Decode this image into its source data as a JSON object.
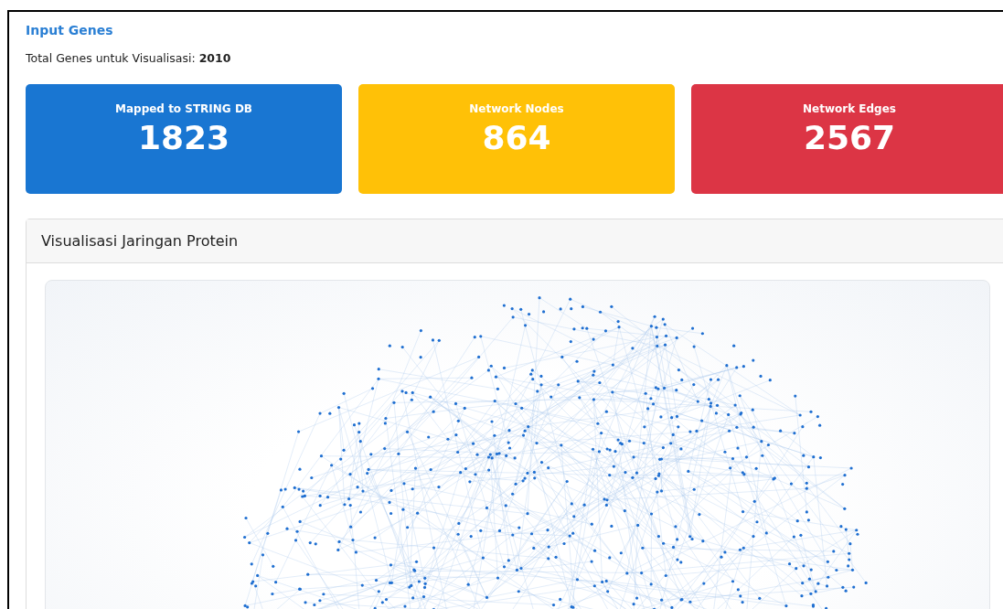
{
  "section_link": "Input Genes",
  "total_genes": {
    "label": "Total Genes untuk Visualisasi:",
    "value": "2010"
  },
  "stat_cards": [
    {
      "label": "Mapped to STRING DB",
      "value": "1823",
      "color": "#1976d2"
    },
    {
      "label": "Network Nodes",
      "value": "864",
      "color": "#ffc107"
    },
    {
      "label": "Network Edges",
      "value": "2567",
      "color": "#dc3545"
    }
  ],
  "panel": {
    "title": "Visualisasi Jaringan Protein"
  }
}
